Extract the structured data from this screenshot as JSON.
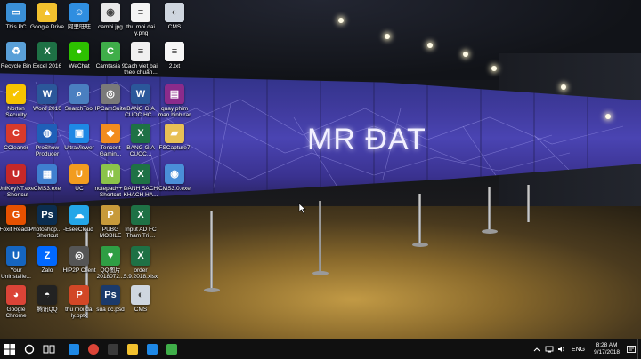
{
  "wallpaper": {
    "wall_text": "MR ĐAT"
  },
  "desktop": {
    "icons": [
      {
        "label": "This PC",
        "icon": "this-pc-icon",
        "color": "#3a8fd6",
        "glyph": "▭"
      },
      {
        "label": "Google Drive",
        "icon": "google-drive-icon",
        "color": "#f2c12e",
        "glyph": "▲"
      },
      {
        "label": "阿里旺旺",
        "icon": "aliwangwang-icon",
        "color": "#2f8ee0",
        "glyph": "☺"
      },
      {
        "label": "camhi.jpg",
        "icon": "image-file-icon",
        "color": "#e8e8e8",
        "glyph": "◉"
      },
      {
        "label": "thu moi dai ly.png",
        "icon": "image-file-icon",
        "color": "#f4f4f4",
        "glyph": "≡"
      },
      {
        "label": "CMS",
        "icon": "cms-icon",
        "color": "#cfd6df",
        "glyph": "◐"
      },
      {
        "label": "Recycle Bin",
        "icon": "recycle-bin-icon",
        "color": "#5aa0d8",
        "glyph": "♻"
      },
      {
        "label": "Excel 2016",
        "icon": "excel-icon",
        "color": "#1e7145",
        "glyph": "X"
      },
      {
        "label": "WeChat",
        "icon": "wechat-icon",
        "color": "#2dc100",
        "glyph": "●"
      },
      {
        "label": "Camtasia 9",
        "icon": "camtasia-icon",
        "color": "#3fae49",
        "glyph": "C"
      },
      {
        "label": "Cach viet bai theo chuẩn...",
        "icon": "document-icon",
        "color": "#f0f0f0",
        "glyph": "≡"
      },
      {
        "label": "2.txt",
        "icon": "text-file-icon",
        "color": "#f6f6f6",
        "glyph": "≡"
      },
      {
        "label": "Norton Security",
        "icon": "norton-icon",
        "color": "#f7c400",
        "glyph": "✓"
      },
      {
        "label": "Word 2016",
        "icon": "word-icon",
        "color": "#2b579a",
        "glyph": "W"
      },
      {
        "label": "SearchTool",
        "icon": "search-icon",
        "color": "#4a7fc0",
        "glyph": "⌕"
      },
      {
        "label": "IPCamSuite",
        "icon": "camera-icon",
        "color": "#7a7a7a",
        "glyph": "◎"
      },
      {
        "label": "BANG GIA CUOC HC...",
        "icon": "word-doc-icon",
        "color": "#2b579a",
        "glyph": "W"
      },
      {
        "label": "quay phim man hinh.rar",
        "icon": "rar-archive-icon",
        "color": "#8b2b8b",
        "glyph": "▤"
      },
      {
        "label": "CCleaner",
        "icon": "ccleaner-icon",
        "color": "#d93a2b",
        "glyph": "C"
      },
      {
        "label": "ProShow Producer",
        "icon": "proshow-icon",
        "color": "#1f5fb8",
        "glyph": "◍"
      },
      {
        "label": "UltraViewer",
        "icon": "ultraviewer-icon",
        "color": "#1e88e5",
        "glyph": "▣"
      },
      {
        "label": "Tencent Gamin...",
        "icon": "tencent-gaming-icon",
        "color": "#f28c1e",
        "glyph": "◆"
      },
      {
        "label": "BANG GIA CUOC...",
        "icon": "excel-doc-icon",
        "color": "#1e7145",
        "glyph": "X"
      },
      {
        "label": "FSCapture7",
        "icon": "folder-icon",
        "color": "#e8c055",
        "glyph": "▰"
      },
      {
        "label": "UniKeyNT.exe - Shortcut",
        "icon": "unikey-icon",
        "color": "#c62828",
        "glyph": "U"
      },
      {
        "label": "CMS3.exe",
        "icon": "cms3-icon",
        "color": "#3f7fcf",
        "glyph": "▦"
      },
      {
        "label": "UC",
        "icon": "uc-browser-icon",
        "color": "#f29c1f",
        "glyph": "U"
      },
      {
        "label": "notepad++ - Shortcut",
        "icon": "notepad-plus-icon",
        "color": "#8bc34a",
        "glyph": "N"
      },
      {
        "label": "DANH SACH KHACH HA...",
        "icon": "excel-doc-icon",
        "color": "#1e7145",
        "glyph": "X"
      },
      {
        "label": "CMS3.0.exe",
        "icon": "cms-disc-icon",
        "color": "#4a8fd8",
        "glyph": "◉"
      },
      {
        "label": "Foxit Reader",
        "icon": "foxit-reader-icon",
        "color": "#e65100",
        "glyph": "G"
      },
      {
        "label": "Photoshop... - Shortcut",
        "icon": "photoshop-icon",
        "color": "#0b2d4f",
        "glyph": "Ps"
      },
      {
        "label": "EseeCloud",
        "icon": "eseecloud-icon",
        "color": "#23a6e8",
        "glyph": "☁"
      },
      {
        "label": "PUBG MOBILE",
        "icon": "pubg-icon",
        "color": "#c79a3a",
        "glyph": "P"
      },
      {
        "label": "Input AD FC Tham Tri ...",
        "icon": "excel-doc-icon",
        "color": "#1e7145",
        "glyph": "X"
      },
      {
        "label": "Your Uninstalle...",
        "icon": "uninstaller-icon",
        "color": "#1565c0",
        "glyph": "U"
      },
      {
        "label": "Zalo",
        "icon": "zalo-icon",
        "color": "#0068ff",
        "glyph": "Z"
      },
      {
        "label": "HIP2P Client",
        "icon": "hip2p-icon",
        "color": "#555555",
        "glyph": "◎"
      },
      {
        "label": "QQ图片 2018072...",
        "icon": "image-file-icon",
        "color": "#2f9e44",
        "glyph": "♥"
      },
      {
        "label": "order 5.9.2018.xlsx",
        "icon": "excel-doc-icon",
        "color": "#1e7145",
        "glyph": "X"
      },
      {
        "label": "Google Chrome",
        "icon": "chrome-icon",
        "color": "#db4437",
        "glyph": "◕"
      },
      {
        "label": "腾讯QQ",
        "icon": "qq-icon",
        "color": "#222222",
        "glyph": "◓"
      },
      {
        "label": "thu moi dai ly.pptx",
        "icon": "pptx-file-icon",
        "color": "#d24726",
        "glyph": "P"
      },
      {
        "label": "sua qc.psd",
        "icon": "psd-file-icon",
        "color": "#1b3a6b",
        "glyph": "Ps"
      },
      {
        "label": "CMS",
        "icon": "cms-icon",
        "color": "#cfd6df",
        "glyph": "◐"
      }
    ]
  },
  "taskbar": {
    "pinned": [
      {
        "icon": "edge-icon",
        "color": "#1e88e5"
      },
      {
        "icon": "chrome-icon",
        "color": "#db4437"
      },
      {
        "icon": "calculator-icon",
        "color": "#3a3a3a"
      },
      {
        "icon": "file-explorer-icon",
        "color": "#f2c12e"
      },
      {
        "icon": "store-icon",
        "color": "#1e88e5"
      },
      {
        "icon": "camtasia-icon",
        "color": "#3fae49"
      }
    ],
    "tray": {
      "language": "ENG",
      "time": "8:28 AM",
      "date": "9/17/2018"
    }
  }
}
